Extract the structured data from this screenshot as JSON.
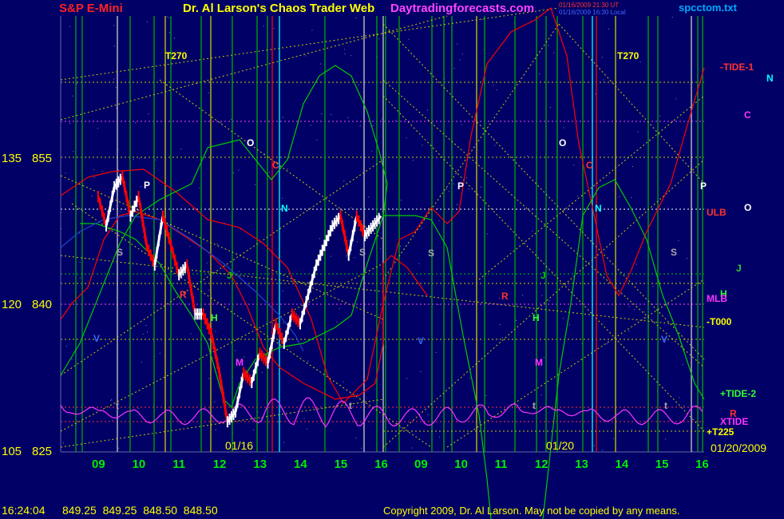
{
  "header": {
    "left_title": "S&P E-Mini",
    "center_title": "Dr. Al Larson's Chaos Trader Web",
    "site": "Daytradingforecasts.com",
    "timestamp_utc": "01/16/2009 21:30 UT",
    "timestamp_local": "01/16/2009 16:30 Local",
    "file": "spcctom.txt"
  },
  "footer": {
    "time": "16:24:04",
    "quotes": "849.25  849.25  848.50  848.50",
    "copyright": "Copyright 2009, Dr. Al Larson. May not be copied by any means."
  },
  "colors": {
    "background": "#000066",
    "price_up": "#ffffff",
    "price_down": "#ff0000",
    "red_line": "#ff0000",
    "green_line": "#00cc00",
    "magenta_line": "#ff33ff",
    "yellow_text": "#ffff00",
    "vline_green": "#00aa00",
    "vline_yellow": "#cccc00",
    "vline_cyan": "#00ffff",
    "vline_red": "#ff0000",
    "vline_white": "#cccccc"
  },
  "chart_data": {
    "type": "line",
    "title": "S&P E-Mini",
    "y_tick_labels": [
      {
        "left": "135",
        "right": "855"
      },
      {
        "left": "120",
        "right": "840"
      },
      {
        "left": "105",
        "right": "825"
      }
    ],
    "x_ticks_day1": [
      "09",
      "10",
      "11",
      "12",
      "13",
      "14",
      "15",
      "16"
    ],
    "x_ticks_day2": [
      "09",
      "10",
      "11",
      "12",
      "13",
      "14",
      "15",
      "16"
    ],
    "date_labels": [
      "01/16",
      "01/20",
      "01/20/2009"
    ],
    "right_labels": [
      {
        "text": "-TIDE-1",
        "color": "#ff3333"
      },
      {
        "text": "N",
        "color": "#00ffff"
      },
      {
        "text": "C",
        "color": "#ff33ff"
      },
      {
        "text": "ULB",
        "color": "#ff3333"
      },
      {
        "text": "O",
        "color": "#ffffff"
      },
      {
        "text": "J",
        "color": "#33cc33"
      },
      {
        "text": "H",
        "color": "#33ff33"
      },
      {
        "text": "MLB",
        "color": "#ff33ff"
      },
      {
        "text": "-T000",
        "color": "#ffff00"
      },
      {
        "text": "+TIDE-2",
        "color": "#33ff33"
      },
      {
        "text": "R",
        "color": "#ff3333"
      },
      {
        "text": "XTIDE",
        "color": "#ff33ff"
      },
      {
        "text": "+T225",
        "color": "#ffff00"
      }
    ],
    "in_chart_labels": [
      {
        "text": "T270",
        "color": "#ffff00"
      },
      {
        "text": "T270",
        "color": "#ffff00"
      },
      {
        "text": "O",
        "color": "#ffffff"
      },
      {
        "text": "O",
        "color": "#ffffff"
      },
      {
        "text": "C",
        "color": "#ff3333"
      },
      {
        "text": "C",
        "color": "#ff3333"
      },
      {
        "text": "P",
        "color": "#ffffff"
      },
      {
        "text": "P",
        "color": "#ffffff"
      },
      {
        "text": "P",
        "color": "#ffffff"
      },
      {
        "text": "N",
        "color": "#00ffff"
      },
      {
        "text": "N",
        "color": "#00ffff"
      },
      {
        "text": "S",
        "color": "#aaaaaa"
      },
      {
        "text": "S",
        "color": "#aaaaaa"
      },
      {
        "text": "S",
        "color": "#aaaaaa"
      },
      {
        "text": "S",
        "color": "#aaaaaa"
      },
      {
        "text": "J",
        "color": "#00cc00"
      },
      {
        "text": "J",
        "color": "#00cc00"
      },
      {
        "text": "R",
        "color": "#ff3333"
      },
      {
        "text": "R",
        "color": "#ff3333"
      },
      {
        "text": "H",
        "color": "#33ff33"
      },
      {
        "text": "H",
        "color": "#33ff33"
      },
      {
        "text": "M",
        "color": "#ff33ff"
      },
      {
        "text": "M",
        "color": "#ff33ff"
      },
      {
        "text": "V",
        "color": "#3366ff"
      },
      {
        "text": "V",
        "color": "#3366ff"
      },
      {
        "text": "V",
        "color": "#3366ff"
      },
      {
        "text": "t",
        "color": "#aaaaaa"
      },
      {
        "text": "t",
        "color": "#aaaaaa"
      },
      {
        "text": "t",
        "color": "#aaaaaa"
      },
      {
        "text": "t",
        "color": "#aaaaaa"
      }
    ],
    "price_series_01_16": [
      [
        9.0,
        851
      ],
      [
        9.2,
        848
      ],
      [
        9.4,
        852
      ],
      [
        9.6,
        853
      ],
      [
        9.8,
        849
      ],
      [
        10.0,
        851
      ],
      [
        10.2,
        846
      ],
      [
        10.4,
        844
      ],
      [
        10.6,
        849
      ],
      [
        10.8,
        846
      ],
      [
        11.0,
        843
      ],
      [
        11.2,
        844
      ],
      [
        11.4,
        839
      ],
      [
        11.6,
        839
      ],
      [
        11.8,
        837
      ],
      [
        12.0,
        833
      ],
      [
        12.2,
        828
      ],
      [
        12.4,
        829
      ],
      [
        12.6,
        833
      ],
      [
        12.8,
        832
      ],
      [
        13.0,
        835
      ],
      [
        13.2,
        834
      ],
      [
        13.4,
        838
      ],
      [
        13.6,
        836
      ],
      [
        13.8,
        839
      ],
      [
        14.0,
        838
      ],
      [
        14.2,
        841
      ],
      [
        14.4,
        844
      ],
      [
        14.6,
        846
      ],
      [
        14.8,
        848
      ],
      [
        15.0,
        849
      ],
      [
        15.2,
        845
      ],
      [
        15.4,
        849
      ],
      [
        15.6,
        847
      ],
      [
        15.8,
        848
      ],
      [
        16.0,
        849
      ]
    ],
    "ylim": [
      825,
      862
    ]
  }
}
